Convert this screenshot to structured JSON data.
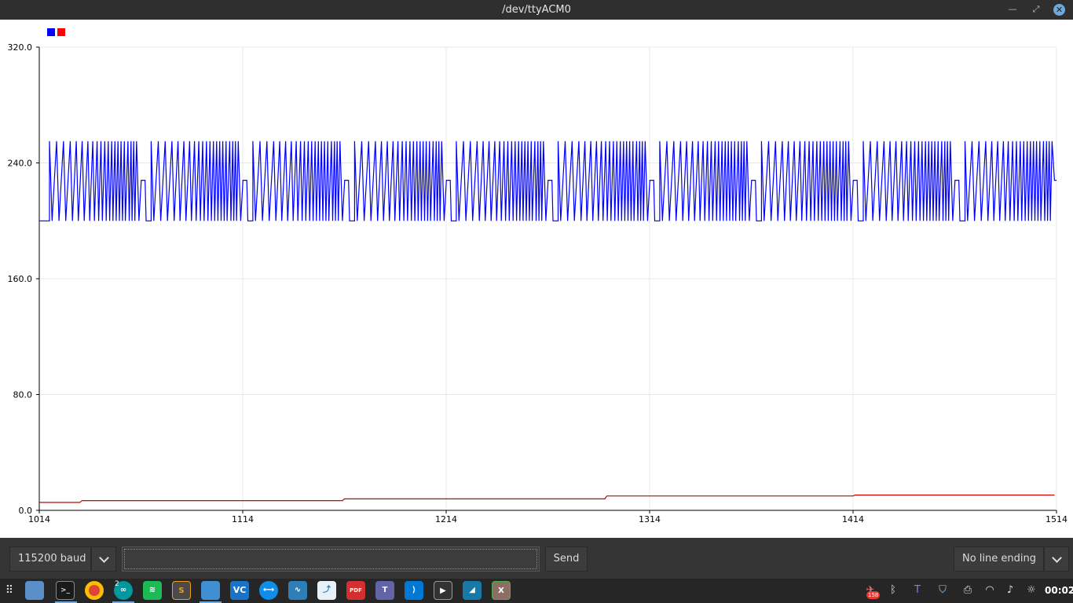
{
  "window": {
    "title": "/dev/ttyACM0"
  },
  "chart_data": {
    "type": "line",
    "x_range": [
      1014,
      1514
    ],
    "ylim": [
      0.0,
      320.0
    ],
    "x_ticks": [
      "1014",
      "1114",
      "1214",
      "1314",
      "1414",
      "1514"
    ],
    "y_ticks": [
      "0.0",
      "80.0",
      "160.0",
      "240.0",
      "320.0"
    ],
    "grid": true,
    "legend_placement": "top-left",
    "series": [
      {
        "color": "#0000ff",
        "pattern": {
          "period": 50,
          "first_burst_start": 1019,
          "low": 200,
          "high": 255,
          "mid": 228,
          "burst_crossings": [
            1019.0,
            1020.3,
            1022.5,
            1023.7,
            1025.9,
            1027.0,
            1029.2,
            1030.3,
            1032.2,
            1033.2,
            1035.1,
            1036.1,
            1037.9,
            1038.8,
            1040.3,
            1041.1,
            1042.4,
            1043.2,
            1044.3,
            1045.0,
            1046.2,
            1046.9,
            1047.9,
            1048.6,
            1049.6,
            1050.2,
            1051.2,
            1051.8,
            1052.7,
            1053.4,
            1054.2,
            1054.9,
            1055.8,
            1056.3,
            1057.6,
            1058.2,
            1059.1,
            1059.6,
            1060.4,
            1061.0,
            1061.8
          ],
          "mid_step": [
            1063.0,
            1064.1,
            1066.0,
            1066.5
          ]
        }
      },
      {
        "color": "#cc0000",
        "points": [
          [
            1014,
            5.5
          ],
          [
            1034,
            5.5
          ],
          [
            1035,
            6.7
          ],
          [
            1163,
            6.7
          ],
          [
            1164,
            7.9
          ],
          [
            1292,
            7.9
          ],
          [
            1293,
            9.9
          ],
          [
            1414,
            9.9
          ],
          [
            1415,
            10.6
          ],
          [
            1513,
            10.6
          ]
        ]
      }
    ]
  },
  "controls": {
    "baud_label": "115200 baud",
    "message_value": "",
    "send_label": "Send",
    "line_ending_label": "No line ending"
  },
  "taskbar": {
    "apps": [
      {
        "name": "app-grid-icon"
      },
      {
        "name": "desktop-icon"
      },
      {
        "name": "terminal-icon"
      },
      {
        "name": "chrome-icon"
      },
      {
        "name": "arduino-icon"
      },
      {
        "name": "spotify-icon"
      },
      {
        "name": "sublime-icon"
      },
      {
        "name": "files-icon"
      },
      {
        "name": "vc-icon"
      },
      {
        "name": "teamviewer-icon"
      },
      {
        "name": "monitor-icon"
      },
      {
        "name": "flow-icon"
      },
      {
        "name": "pdf-icon"
      },
      {
        "name": "teams-icon"
      },
      {
        "name": "vscode-icon"
      },
      {
        "name": "video-editor-icon"
      },
      {
        "name": "wireshark-icon"
      },
      {
        "name": "xming-icon"
      }
    ],
    "workspace_number": "2",
    "tray_badge": "158",
    "vc_label": "VC",
    "pdf_label": "PDF",
    "clock": "00:02"
  }
}
